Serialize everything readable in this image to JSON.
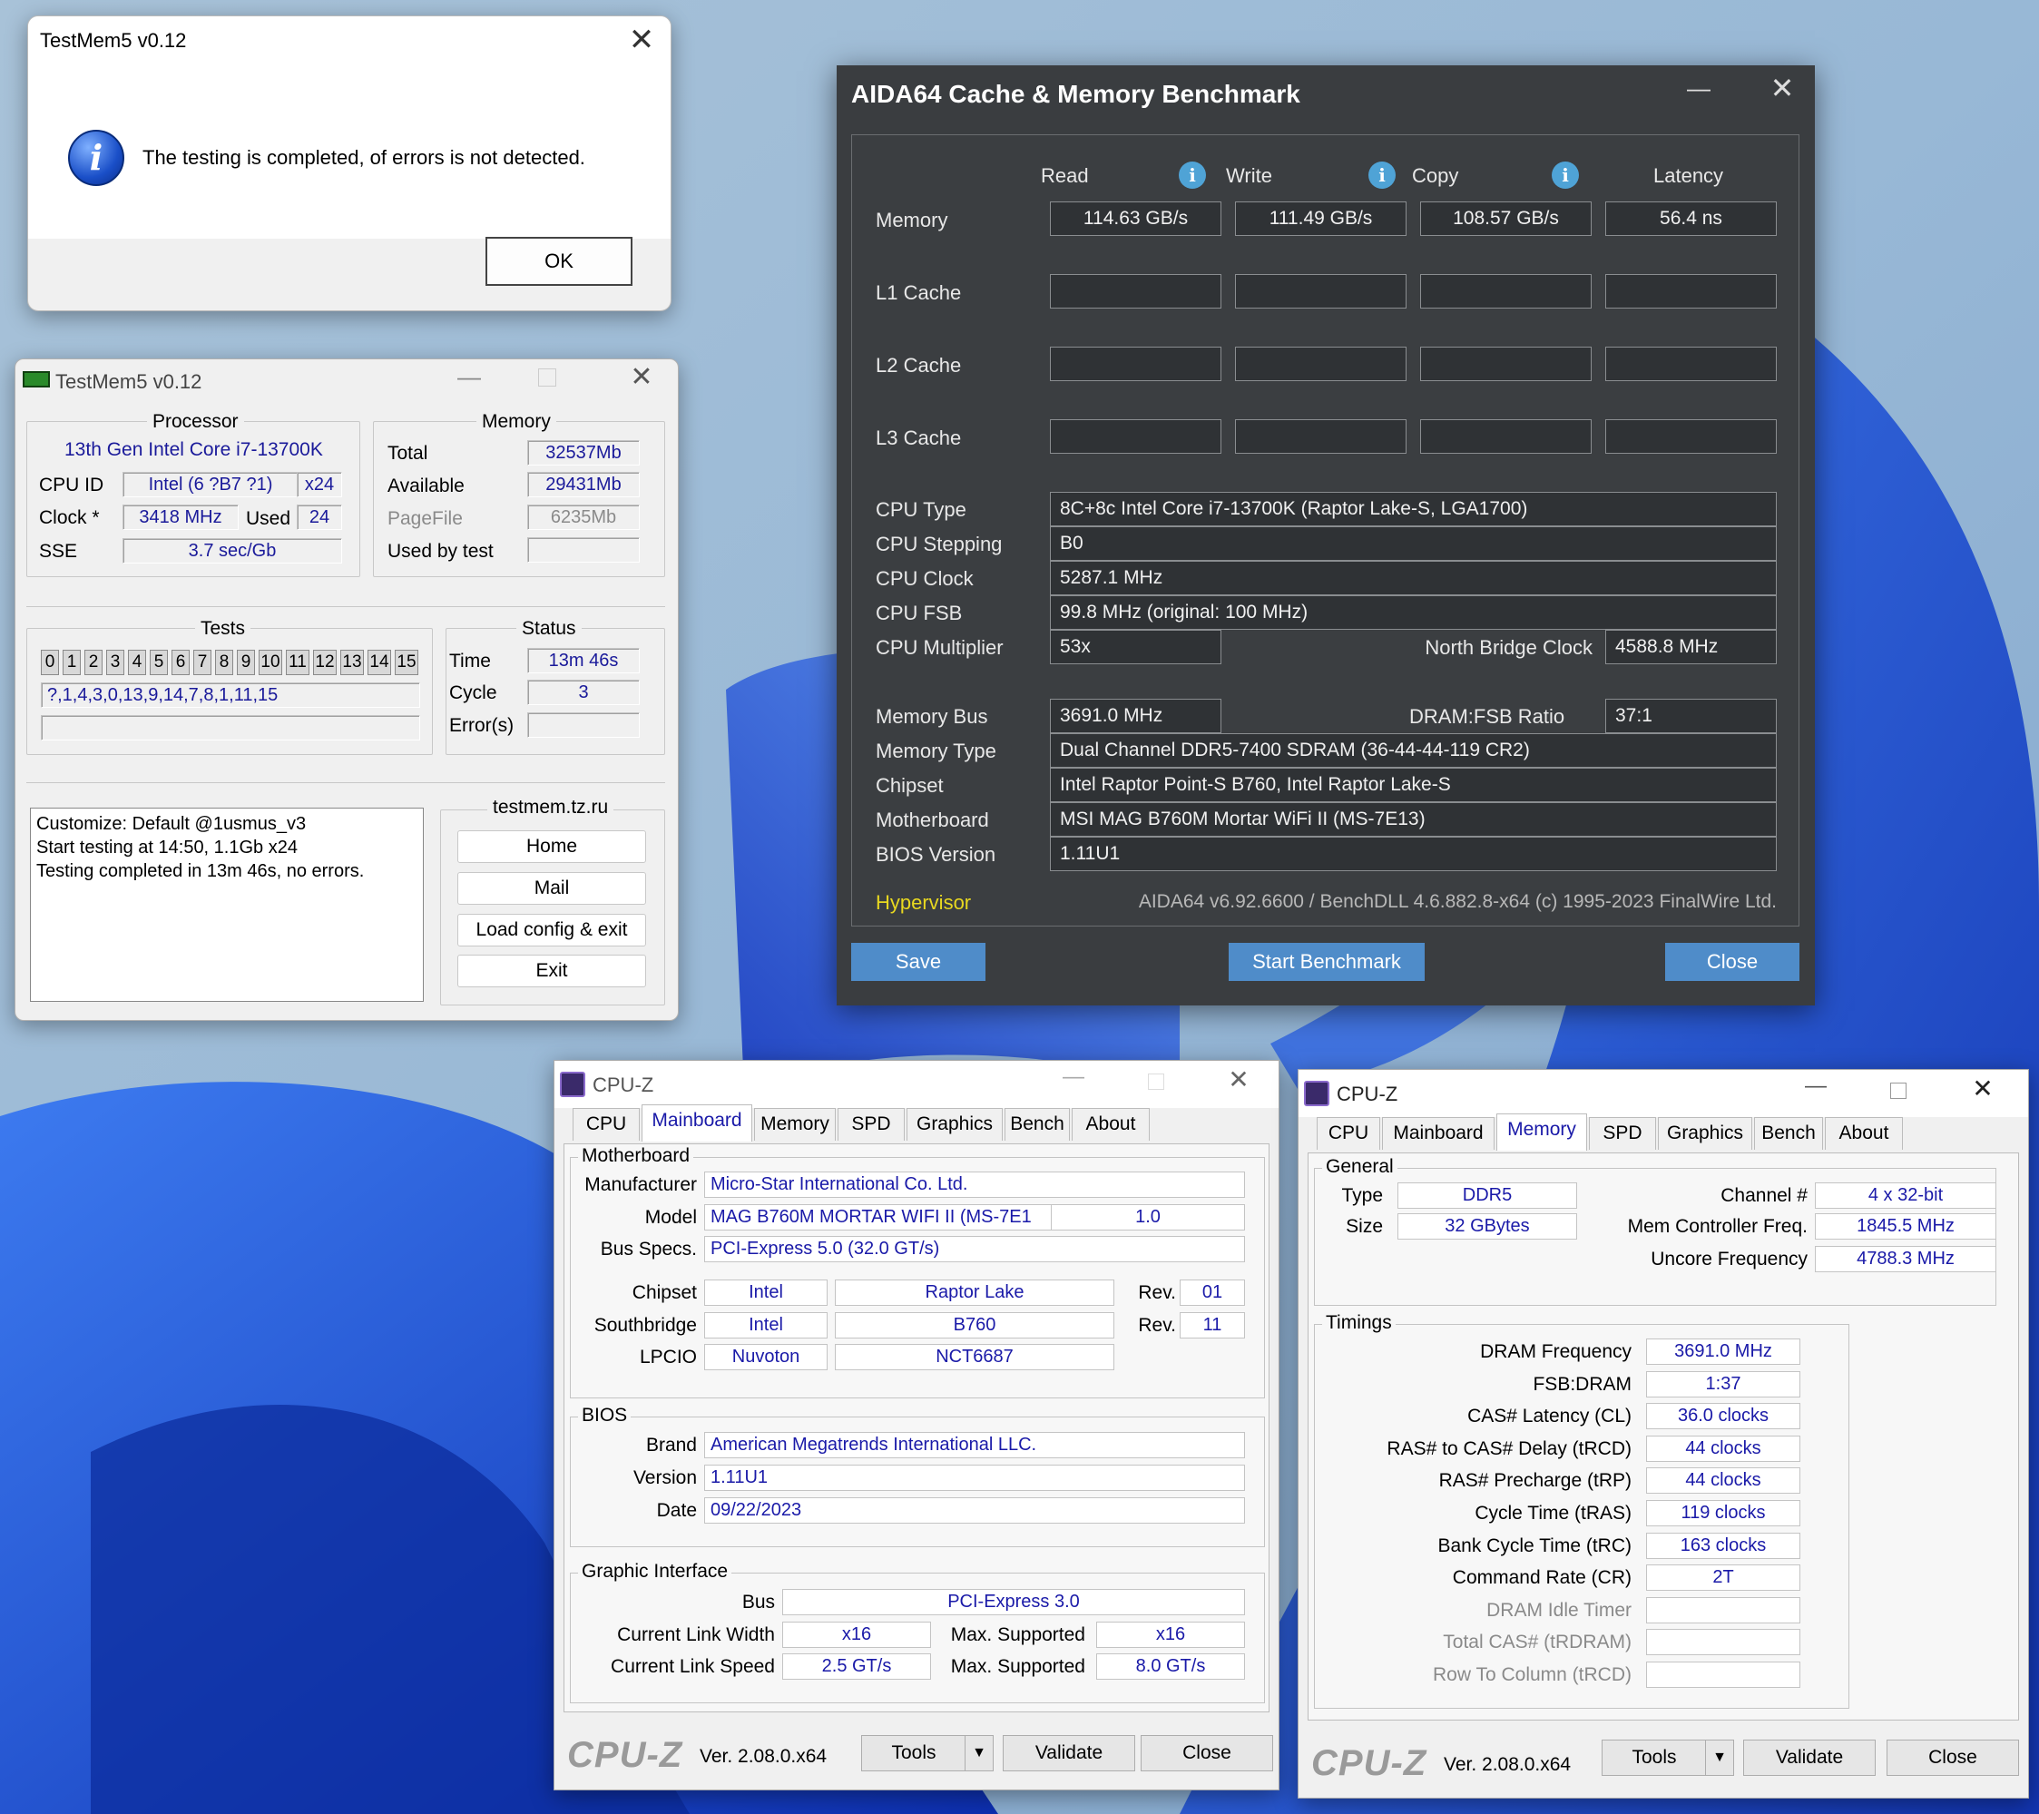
{
  "msgbox": {
    "title": "TestMem5 v0.12",
    "message": "The testing is completed, of errors is not detected.",
    "ok_label": "OK"
  },
  "testmem": {
    "title": "TestMem5 v0.12",
    "processor_header": "Processor",
    "cpu_name": "13th Gen Intel Core i7-13700K",
    "cpu_id_label": "CPU ID",
    "cpu_id_value": "Intel  (6 ?B7 ?1)",
    "cpu_threads": "x24",
    "clock_label": "Clock *",
    "clock_value": "3418 MHz",
    "used_label": "Used",
    "used_value": "24",
    "sse_label": "SSE",
    "sse_value": "3.7 sec/Gb",
    "memory_header": "Memory",
    "total_label": "Total",
    "total_value": "32537Mb",
    "available_label": "Available",
    "available_value": "29431Mb",
    "pagefile_label": "PageFile",
    "pagefile_value": "6235Mb",
    "usedbytest_label": "Used by test",
    "usedbytest_value": "",
    "tests_header": "Tests",
    "test_numbers": [
      "0",
      "1",
      "2",
      "3",
      "4",
      "5",
      "6",
      "7",
      "8",
      "9",
      "10",
      "11",
      "12",
      "13",
      "14",
      "15"
    ],
    "test_sequence": "?,1,4,3,0,13,9,14,7,8,1,11,15",
    "status_header": "Status",
    "time_label": "Time",
    "time_value": "13m 46s",
    "cycle_label": "Cycle",
    "cycle_value": "3",
    "errors_label": "Error(s)",
    "errors_value": "",
    "log_lines": [
      "Customize: Default @1usmus_v3",
      "Start testing at 14:50, 1.1Gb x24",
      "Testing completed in 13m 46s, no errors."
    ],
    "site_label": "testmem.tz.ru",
    "buttons": [
      "Home",
      "Mail",
      "Load config & exit",
      "Exit"
    ]
  },
  "aida": {
    "title": "AIDA64 Cache & Memory Benchmark",
    "col_read": "Read",
    "col_write": "Write",
    "col_copy": "Copy",
    "col_latency": "Latency",
    "rows": [
      {
        "label": "Memory",
        "read": "114.63 GB/s",
        "write": "111.49 GB/s",
        "copy": "108.57 GB/s",
        "latency": "56.4 ns"
      },
      {
        "label": "L1 Cache",
        "read": "",
        "write": "",
        "copy": "",
        "latency": ""
      },
      {
        "label": "L2 Cache",
        "read": "",
        "write": "",
        "copy": "",
        "latency": ""
      },
      {
        "label": "L3 Cache",
        "read": "",
        "write": "",
        "copy": "",
        "latency": ""
      }
    ],
    "cpu_type_label": "CPU Type",
    "cpu_type": "8C+8c Intel Core i7-13700K  (Raptor Lake-S, LGA1700)",
    "cpu_stepping_label": "CPU Stepping",
    "cpu_stepping": "B0",
    "cpu_clock_label": "CPU Clock",
    "cpu_clock": "5287.1 MHz",
    "cpu_fsb_label": "CPU FSB",
    "cpu_fsb": "99.8 MHz  (original: 100 MHz)",
    "cpu_mult_label": "CPU Multiplier",
    "cpu_mult": "53x",
    "nb_clock_label": "North Bridge Clock",
    "nb_clock": "4588.8 MHz",
    "mem_bus_label": "Memory Bus",
    "mem_bus": "3691.0 MHz",
    "dram_ratio_label": "DRAM:FSB Ratio",
    "dram_ratio": "37:1",
    "mem_type_label": "Memory Type",
    "mem_type": "Dual Channel DDR5-7400 SDRAM  (36-44-44-119 CR2)",
    "chipset_label": "Chipset",
    "chipset": "Intel Raptor Point-S B760, Intel Raptor Lake-S",
    "mobo_label": "Motherboard",
    "mobo": "MSI MAG B760M Mortar WiFi II (MS-7E13)",
    "bios_label": "BIOS Version",
    "bios": "1.11U1",
    "hypervisor": "Hypervisor",
    "version": "AIDA64 v6.92.6600 / BenchDLL 4.6.882.8-x64  (c) 1995-2023 FinalWire Ltd.",
    "btn_save": "Save",
    "btn_start": "Start Benchmark",
    "btn_close": "Close"
  },
  "cpuz1": {
    "title": "CPU-Z",
    "tabs": [
      "CPU",
      "Mainboard",
      "Memory",
      "SPD",
      "Graphics",
      "Bench",
      "About"
    ],
    "selected_tab": "Mainboard",
    "mb_group": "Motherboard",
    "manufacturer_label": "Manufacturer",
    "manufacturer": "Micro-Star International Co. Ltd.",
    "model_label": "Model",
    "model": "MAG B760M MORTAR WIFI II (MS-7E1",
    "model_rev": "1.0",
    "busspecs_label": "Bus Specs.",
    "busspecs": "PCI-Express 5.0 (32.0 GT/s)",
    "chipset_label": "Chipset",
    "chipset_vendor": "Intel",
    "chipset_name": "Raptor Lake",
    "rev_label": "Rev.",
    "chipset_rev": "01",
    "southbridge_label": "Southbridge",
    "sb_vendor": "Intel",
    "sb_name": "B760",
    "sb_rev": "11",
    "lpcio_label": "LPCIO",
    "lpcio_vendor": "Nuvoton",
    "lpcio_name": "NCT6687",
    "bios_group": "BIOS",
    "brand_label": "Brand",
    "brand": "American Megatrends International LLC.",
    "version_label": "Version",
    "version": "1.11U1",
    "date_label": "Date",
    "date": "09/22/2023",
    "gi_group": "Graphic Interface",
    "bus_label": "Bus",
    "bus": "PCI-Express 3.0",
    "clw_label": "Current Link Width",
    "clw": "x16",
    "maxs_label": "Max. Supported",
    "maxw": "x16",
    "cls_label": "Current Link Speed",
    "cls": "2.5 GT/s",
    "maxsp": "8.0 GT/s",
    "logo": "CPU-Z",
    "ver": "Ver. 2.08.0.x64",
    "tools": "Tools",
    "validate": "Validate",
    "close": "Close"
  },
  "cpuz2": {
    "title": "CPU-Z",
    "tabs": [
      "CPU",
      "Mainboard",
      "Memory",
      "SPD",
      "Graphics",
      "Bench",
      "About"
    ],
    "selected_tab": "Memory",
    "general_group": "General",
    "type_label": "Type",
    "type": "DDR5",
    "size_label": "Size",
    "size": "32 GBytes",
    "channel_label": "Channel #",
    "channel": "4 x 32-bit",
    "mcf_label": "Mem Controller Freq.",
    "mcf": "1845.5 MHz",
    "uncore_label": "Uncore Frequency",
    "uncore": "4788.3 MHz",
    "timings_group": "Timings",
    "timings": [
      {
        "label": "DRAM Frequency",
        "value": "3691.0 MHz",
        "disabled": false
      },
      {
        "label": "FSB:DRAM",
        "value": "1:37",
        "disabled": false
      },
      {
        "label": "CAS# Latency (CL)",
        "value": "36.0 clocks",
        "disabled": false
      },
      {
        "label": "RAS# to CAS# Delay (tRCD)",
        "value": "44 clocks",
        "disabled": false
      },
      {
        "label": "RAS# Precharge (tRP)",
        "value": "44 clocks",
        "disabled": false
      },
      {
        "label": "Cycle Time (tRAS)",
        "value": "119 clocks",
        "disabled": false
      },
      {
        "label": "Bank Cycle Time (tRC)",
        "value": "163 clocks",
        "disabled": false
      },
      {
        "label": "Command Rate (CR)",
        "value": "2T",
        "disabled": false
      },
      {
        "label": "DRAM Idle Timer",
        "value": "",
        "disabled": true
      },
      {
        "label": "Total CAS# (tRDRAM)",
        "value": "",
        "disabled": true
      },
      {
        "label": "Row To Column (tRCD)",
        "value": "",
        "disabled": true
      }
    ],
    "logo": "CPU-Z",
    "ver": "Ver. 2.08.0.x64",
    "tools": "Tools",
    "validate": "Validate",
    "close": "Close"
  }
}
